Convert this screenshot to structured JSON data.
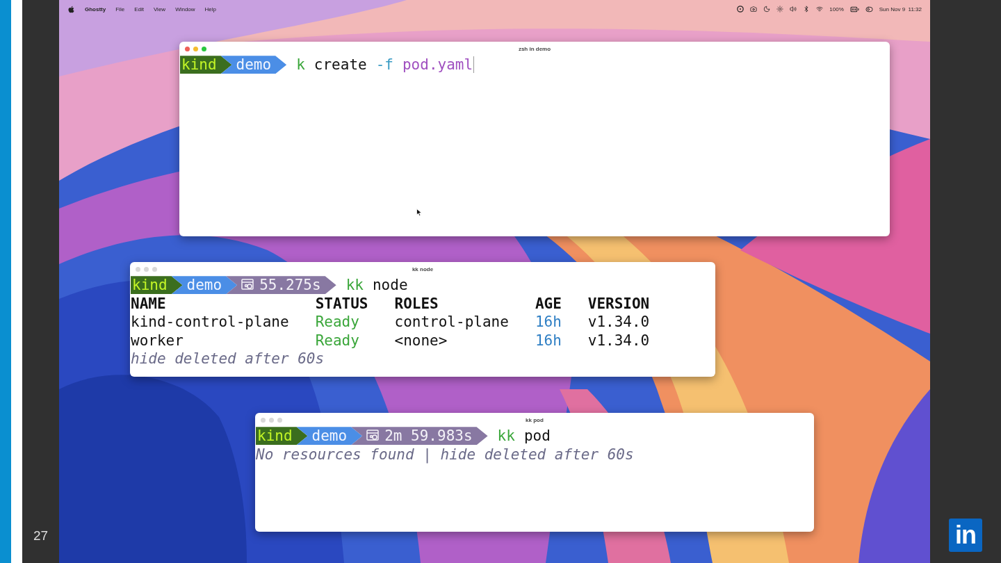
{
  "slide": {
    "number": "27",
    "logo": "in"
  },
  "menu_bar": {
    "app": "Ghostty",
    "menus": [
      "File",
      "Edit",
      "View",
      "Window",
      "Help"
    ],
    "battery": "100%",
    "clock": "Sun Nov 9  11:32"
  },
  "windows": [
    {
      "title": "zsh in demo",
      "active": true,
      "prompt": [
        {
          "kind": "context",
          "text": "kind"
        },
        {
          "kind": "dir",
          "text": "demo"
        }
      ],
      "command": [
        {
          "kind": "cmd",
          "text": "k"
        },
        {
          "kind": "arg",
          "text": "create"
        },
        {
          "kind": "flag",
          "text": "-f"
        },
        {
          "kind": "path",
          "text": "pod.yaml"
        }
      ]
    },
    {
      "title": "kk node",
      "active": false,
      "prompt": [
        {
          "kind": "context",
          "text": "kind"
        },
        {
          "kind": "dir",
          "text": "demo"
        },
        {
          "kind": "timer",
          "text": "55.275s"
        }
      ],
      "command": [
        {
          "kind": "cmd",
          "text": "kk"
        },
        {
          "kind": "arg",
          "text": "node"
        }
      ],
      "table": {
        "columns": [
          {
            "label": "NAME",
            "kind": "text"
          },
          {
            "label": "STATUS",
            "kind": "status"
          },
          {
            "label": "ROLES",
            "kind": "text"
          },
          {
            "label": "AGE",
            "kind": "age"
          },
          {
            "label": "VERSION",
            "kind": "text"
          }
        ],
        "rows": [
          [
            "kind-control-plane",
            "Ready",
            "control-plane",
            "16h",
            "v1.34.0"
          ],
          [
            "worker",
            "Ready",
            "<none>",
            "16h",
            "v1.34.0"
          ]
        ]
      },
      "note": "hide deleted after 60s"
    },
    {
      "title": "kk pod",
      "active": false,
      "prompt": [
        {
          "kind": "context",
          "text": "kind"
        },
        {
          "kind": "dir",
          "text": "demo"
        },
        {
          "kind": "timer",
          "text": "2m 59.983s"
        }
      ],
      "command": [
        {
          "kind": "cmd",
          "text": "kk"
        },
        {
          "kind": "arg",
          "text": "pod"
        }
      ],
      "note": "No resources found | hide deleted after 60s"
    }
  ]
}
